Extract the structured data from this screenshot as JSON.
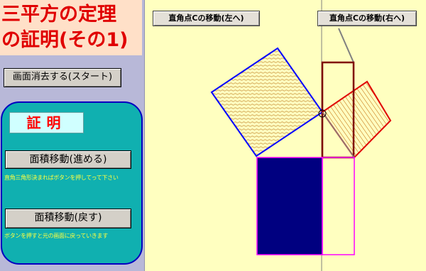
{
  "title": {
    "line1": "三平方の定理",
    "line2": "の証明(その1)"
  },
  "buttons": {
    "clear_start": "画面消去する(スタート)",
    "move_area_forward": "面積移動(進める)",
    "move_area_back": "面積移動(戻す)",
    "move_c_left": "直角点Cの移動(左へ)",
    "move_c_right": "直角点Cの移動(右へ)"
  },
  "proof_label": "証明",
  "hints": {
    "forward": "直角三角形決まればボタンを押してって下さい",
    "back": "ボタンを押すと元の画面に戻っていきます"
  },
  "colors": {
    "background": "#ffffc0",
    "sidebar": "#b8b8d8",
    "title_text": "#e00000",
    "panel": "#10b0b0",
    "left_square_border": "#0000ff",
    "right_square_border": "#e00000",
    "filled_rect": "#000080",
    "outline_magenta": "#ff00ff",
    "brown_rect": "#800000"
  }
}
